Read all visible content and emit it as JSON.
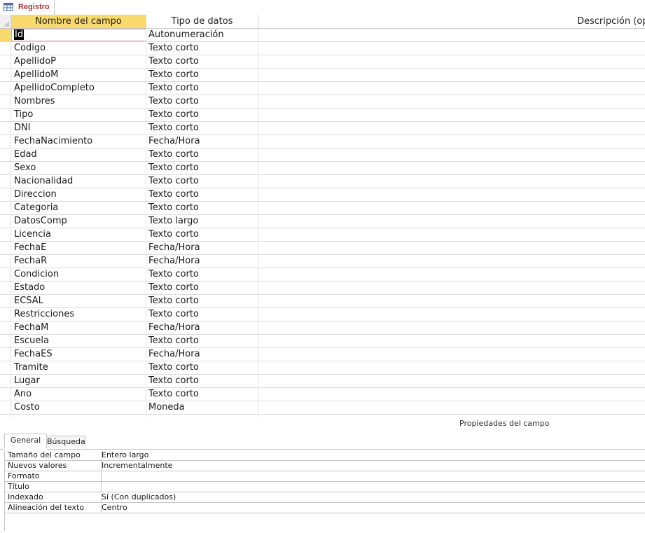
{
  "document_tab": {
    "label": "Registro",
    "icon": "table-icon"
  },
  "grid": {
    "headers": {
      "name": "Nombre del campo",
      "type": "Tipo de datos",
      "description": "Descripción (op"
    },
    "active_row": 0,
    "rows": [
      {
        "name": "Id",
        "type": "Autonumeración"
      },
      {
        "name": "Codigo",
        "type": "Texto corto"
      },
      {
        "name": "ApellidoP",
        "type": "Texto corto"
      },
      {
        "name": "ApellidoM",
        "type": "Texto corto"
      },
      {
        "name": "ApellidoCompleto",
        "type": "Texto corto"
      },
      {
        "name": "Nombres",
        "type": "Texto corto"
      },
      {
        "name": "Tipo",
        "type": "Texto corto"
      },
      {
        "name": "DNI",
        "type": "Texto corto"
      },
      {
        "name": "FechaNacimiento",
        "type": "Fecha/Hora"
      },
      {
        "name": "Edad",
        "type": "Texto corto"
      },
      {
        "name": "Sexo",
        "type": "Texto corto"
      },
      {
        "name": "Nacionalidad",
        "type": "Texto corto"
      },
      {
        "name": "Direccion",
        "type": "Texto corto"
      },
      {
        "name": "Categoria",
        "type": "Texto corto"
      },
      {
        "name": "DatosComp",
        "type": "Texto largo"
      },
      {
        "name": "Licencia",
        "type": "Texto corto"
      },
      {
        "name": "FechaE",
        "type": "Fecha/Hora"
      },
      {
        "name": "FechaR",
        "type": "Fecha/Hora"
      },
      {
        "name": "Condicion",
        "type": "Texto corto"
      },
      {
        "name": "Estado",
        "type": "Texto corto"
      },
      {
        "name": "ECSAL",
        "type": "Texto corto"
      },
      {
        "name": "Restricciones",
        "type": "Texto corto"
      },
      {
        "name": "FechaM",
        "type": "Fecha/Hora"
      },
      {
        "name": "Escuela",
        "type": "Texto corto"
      },
      {
        "name": "FechaES",
        "type": "Fecha/Hora"
      },
      {
        "name": "Tramite",
        "type": "Texto corto"
      },
      {
        "name": "Lugar",
        "type": "Texto corto"
      },
      {
        "name": "Ano",
        "type": "Texto corto"
      },
      {
        "name": "Costo",
        "type": "Moneda"
      },
      {
        "name": "",
        "type": ""
      }
    ]
  },
  "properties": {
    "title": "Propiedades del campo",
    "tabs": [
      "General",
      "Búsqueda"
    ],
    "active_tab": "General",
    "rows": [
      {
        "label": "Tamaño del campo",
        "value": "Entero largo"
      },
      {
        "label": "Nuevos valores",
        "value": "Incrementalmente"
      },
      {
        "label": "Formato",
        "value": ""
      },
      {
        "label": "Título",
        "value": ""
      },
      {
        "label": "Indexado",
        "value": "Sí (Con duplicados)"
      },
      {
        "label": "Alineación del texto",
        "value": "Centro"
      }
    ]
  },
  "colors": {
    "accent_header": "#f8d96b",
    "tab_label": "#a4373a",
    "active_border": "#e4a1a1"
  }
}
